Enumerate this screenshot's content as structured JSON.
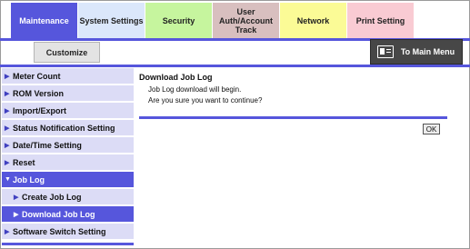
{
  "tabs": [
    {
      "label": "Maintenance",
      "color": "#5656dc",
      "active": true
    },
    {
      "label": "System Settings",
      "color": "#dbe7fb",
      "active": false
    },
    {
      "label": "Security",
      "color": "#c6f59e",
      "active": false
    },
    {
      "label": "User Auth/Account Track",
      "color": "#d8bfbf",
      "active": false
    },
    {
      "label": "Network",
      "color": "#fbfb96",
      "active": false
    },
    {
      "label": "Print Setting",
      "color": "#f9cbd3",
      "active": false
    }
  ],
  "customize_label": "Customize",
  "main_menu": {
    "label": "To Main Menu",
    "icon": "main-menu-icon"
  },
  "sidebar": {
    "items": [
      {
        "label": "Meter Count",
        "arrow": "▶"
      },
      {
        "label": "ROM Version",
        "arrow": "▶"
      },
      {
        "label": "Import/Export",
        "arrow": "▶"
      },
      {
        "label": "Status Notification Setting",
        "arrow": "▶"
      },
      {
        "label": "Date/Time Setting",
        "arrow": "▶"
      },
      {
        "label": "Reset",
        "arrow": "▶"
      },
      {
        "label": "Job Log",
        "arrow": "▼"
      },
      {
        "label": "Create Job Log",
        "arrow": "▶"
      },
      {
        "label": "Download Job Log",
        "arrow": "▶"
      },
      {
        "label": "Software Switch Setting",
        "arrow": "▶"
      }
    ]
  },
  "content": {
    "title": "Download Job Log",
    "line1": "Job Log download will begin.",
    "line2": "Are you sure you want to continue?",
    "ok_label": "OK"
  },
  "colors": {
    "accent": "#5656dc",
    "sidebar_item": "#dcdcf6"
  }
}
